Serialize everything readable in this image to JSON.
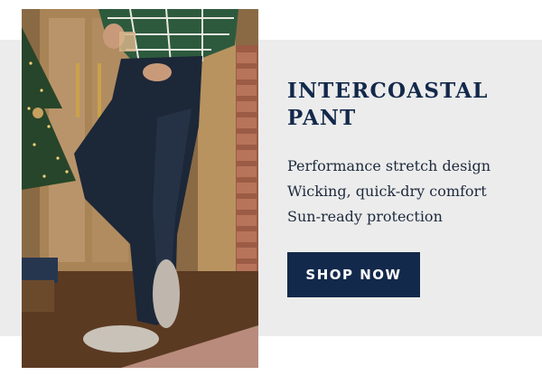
{
  "promo": {
    "title": "INTERCOASTAL PANT",
    "features": [
      "Performance stretch design",
      "Wicking, quick-dry comfort",
      "Sun-ready protection"
    ],
    "cta_label": "SHOP NOW"
  },
  "colors": {
    "band_background": "#ececec",
    "navy": "#13294b",
    "text": "#1d2a3d"
  }
}
